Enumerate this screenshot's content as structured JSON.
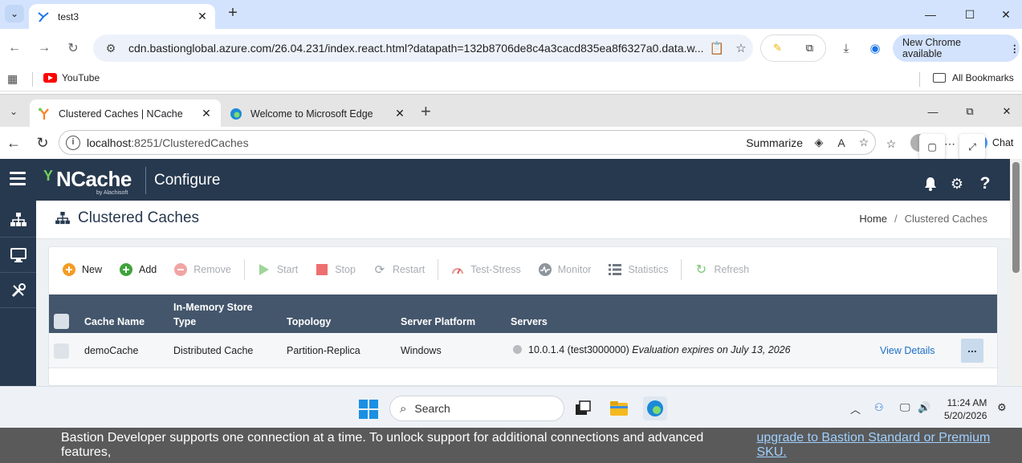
{
  "outer_browser": {
    "tab_title": "test3",
    "url": "cdn.bastionglobal.azure.com/26.04.231/index.react.html?datapath=132b8706de8c4a3cacd835ea8f6327a0.data.w...",
    "update_label": "New Chrome available",
    "bookmarks": [
      {
        "label": "YouTube"
      }
    ],
    "all_bookmarks_label": "All Bookmarks"
  },
  "inner_browser": {
    "tabs": [
      {
        "title": "Clustered Caches | NCache",
        "active": true
      },
      {
        "title": "Welcome to Microsoft Edge",
        "active": false
      }
    ],
    "url_host": "localhost",
    "url_path": ":8251/ClusteredCaches",
    "summarize_label": "Summarize",
    "chat_label": "Chat"
  },
  "app": {
    "logo_text": "NCache",
    "logo_sub": "by Alachisoft",
    "section_title": "Configure",
    "page_title": "Clustered Caches",
    "breadcrumb": {
      "home": "Home",
      "current": "Clustered Caches"
    },
    "toolbar": {
      "new": "New",
      "add": "Add",
      "remove": "Remove",
      "start": "Start",
      "stop": "Stop",
      "restart": "Restart",
      "test_stress": "Test-Stress",
      "monitor": "Monitor",
      "statistics": "Statistics",
      "refresh": "Refresh"
    },
    "table": {
      "columns": {
        "cache_name": "Cache Name",
        "store_type_1": "In-Memory Store",
        "store_type_2": "Type",
        "topology": "Topology",
        "platform": "Server Platform",
        "servers": "Servers"
      },
      "rows": [
        {
          "cache_name": "demoCache",
          "store_type": "Distributed Cache",
          "topology": "Partition-Replica",
          "platform": "Windows",
          "server": "10.0.1.4 (test3000000)",
          "evaluation": "Evaluation expires on July 13, 2026",
          "view_details": "View Details",
          "more": "..."
        }
      ]
    }
  },
  "taskbar": {
    "search_placeholder": "Search",
    "time": "11:24 AM",
    "date": "5/20/2026"
  },
  "banner": {
    "text": "Bastion Developer supports one connection at a time. To unlock support for additional connections and advanced features,",
    "link": "upgrade to Bastion Standard or Premium SKU."
  },
  "colors": {
    "app_header": "#27394f",
    "grid_header": "#44566c",
    "accent_orange": "#ff7f27",
    "accent_green": "#6ed05a",
    "link_blue": "#1a6fc7"
  }
}
